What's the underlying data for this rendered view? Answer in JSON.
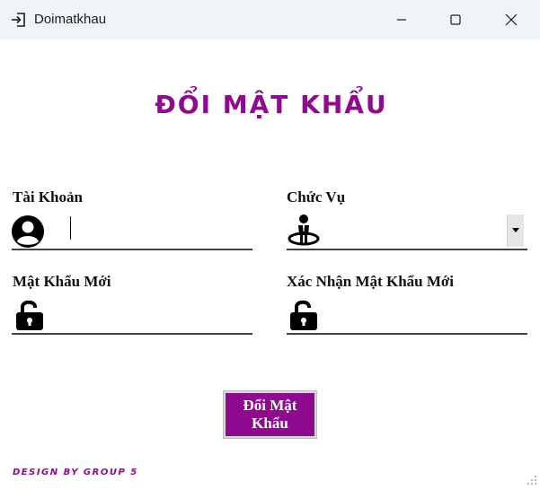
{
  "window": {
    "title": "Doimatkhau"
  },
  "form": {
    "heading": "ĐỔI MẬT KHẨU",
    "account_label": "Tài Khoản",
    "account_value": "",
    "role_label": "Chức Vụ",
    "role_value": "",
    "new_password_label": "Mật Khẩu Mới",
    "new_password_value": "",
    "confirm_password_label": "Xác Nhận Mật Khẩu Mới",
    "confirm_password_value": "",
    "submit_label": "Đổi Mật Khẩu"
  },
  "footer": {
    "text": "DESIGN BY GROUP 5"
  },
  "colors": {
    "accent": "#8e0a8e",
    "titlebar": "#f0f4f9"
  },
  "icons": {
    "app": "login-icon",
    "account": "user-circle-icon",
    "role": "person-position-icon",
    "password": "unlock-icon"
  }
}
